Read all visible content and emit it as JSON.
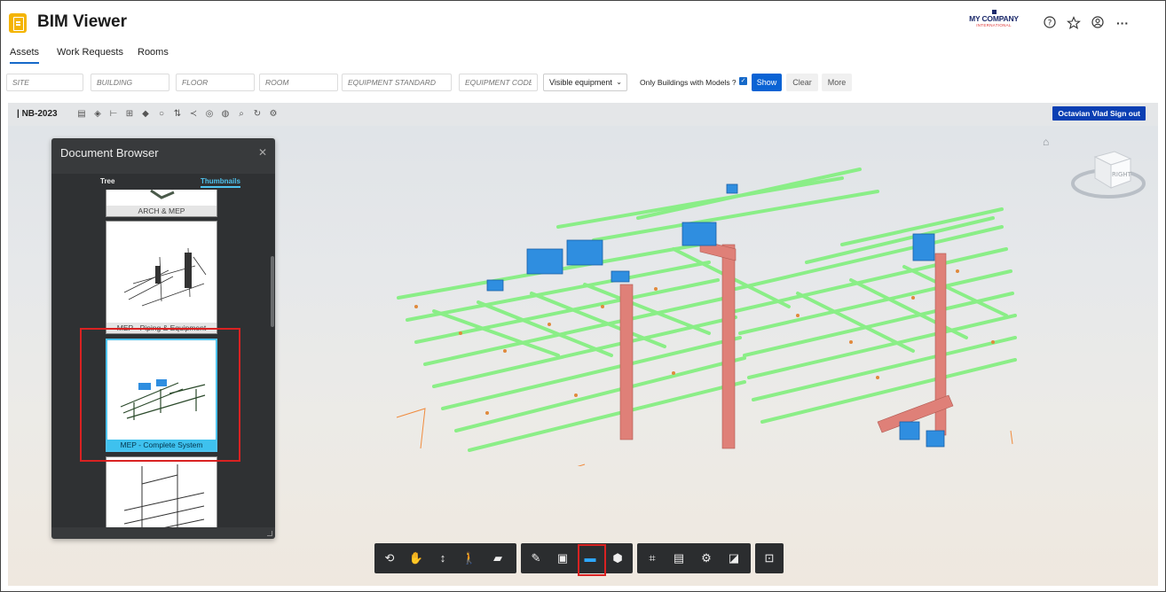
{
  "app": {
    "title": "BIM Viewer",
    "company_name": "MY COMPANY",
    "company_sub": "INTERNATIONAL"
  },
  "header_icons": [
    "help-icon",
    "star-icon",
    "account-icon",
    "more-icon"
  ],
  "tabs": [
    {
      "label": "Assets",
      "active": true
    },
    {
      "label": "Work Requests",
      "active": false
    },
    {
      "label": "Rooms",
      "active": false
    }
  ],
  "filters": {
    "site": "SITE",
    "building": "BUILDING",
    "floor": "FLOOR",
    "room": "ROOM",
    "equipment_standard": "EQUIPMENT STANDARD",
    "equipment_code": "EQUIPMENT CODE",
    "select_value": "Visible equipment",
    "only_buildings_label": "Only Buildings with Models ?",
    "only_buildings_checked": true,
    "show_label": "Show",
    "clear_label": "Clear",
    "more_label": "More"
  },
  "viewer": {
    "model_name": "| NB-2023",
    "signout_label": "Octavian Vlad Sign out",
    "viewcube_label": "RIGHT"
  },
  "document_browser": {
    "title": "Document Browser",
    "tabs": [
      {
        "label": "Tree",
        "active": false
      },
      {
        "label": "Thumbnails",
        "active": true
      }
    ],
    "items": [
      {
        "label": "ARCH & MEP",
        "selected": false
      },
      {
        "label": "MEP - Piping & Equipment",
        "selected": false
      },
      {
        "label": "MEP - Complete System",
        "selected": true
      },
      {
        "label": "",
        "selected": false
      }
    ]
  },
  "colors": {
    "accent": "#0b63d4",
    "pipe": "#8ff08a",
    "duct": "#e0827c",
    "equipment": "#2f8ee0",
    "highlight": "#d92222"
  }
}
